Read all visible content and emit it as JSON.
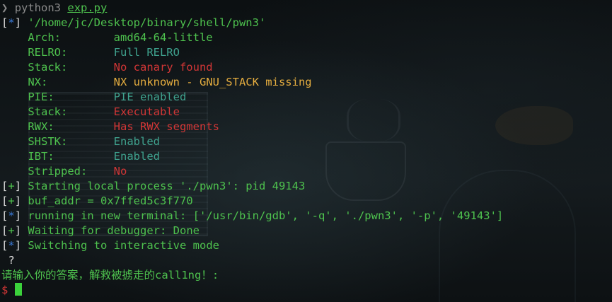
{
  "prompt": {
    "symbol": "❯",
    "command": "python3",
    "script": "exp.py"
  },
  "file_line": {
    "tag": "*",
    "path": "'/home/jc/Desktop/binary/shell/pwn3'"
  },
  "checksec": {
    "arch": {
      "key": "Arch:",
      "value": "amd64-64-little"
    },
    "relro": {
      "key": "RELRO:",
      "value": "Full RELRO"
    },
    "stack": {
      "key": "Stack:",
      "value": "No canary found"
    },
    "nx": {
      "key": "NX:",
      "value": "NX unknown - GNU_STACK missing"
    },
    "pie": {
      "key": "PIE:",
      "value": "PIE enabled"
    },
    "stack2": {
      "key": "Stack:",
      "value": "Executable"
    },
    "rwx": {
      "key": "RWX:",
      "value": "Has RWX segments"
    },
    "shstk": {
      "key": "SHSTK:",
      "value": "Enabled"
    },
    "ibt": {
      "key": "IBT:",
      "value": "Enabled"
    },
    "stripped": {
      "key": "Stripped:",
      "value": "No"
    }
  },
  "log": [
    {
      "tag": "+",
      "text": "Starting local process './pwn3': pid 49143"
    },
    {
      "tag": "+",
      "text": "buf_addr = 0x7ffed5c3f770"
    },
    {
      "tag": "*",
      "text": "running in new terminal: ['/usr/bin/gdb', '-q', './pwn3', '-p', '49143']"
    },
    {
      "tag": "+",
      "text": "Waiting for debugger: Done"
    },
    {
      "tag": "*",
      "text": "Switching to interactive mode"
    }
  ],
  "output": {
    "question": " ?",
    "message": "请输入你的答案，解救被掳走的call1ng！:"
  },
  "shell_prompt": "$",
  "colors": {
    "green": "#4ec24e",
    "teal": "#3fa28e",
    "red": "#d23636",
    "amber": "#e5ad3f",
    "blue": "#3a7ad8",
    "text": "#dcdcdc"
  }
}
